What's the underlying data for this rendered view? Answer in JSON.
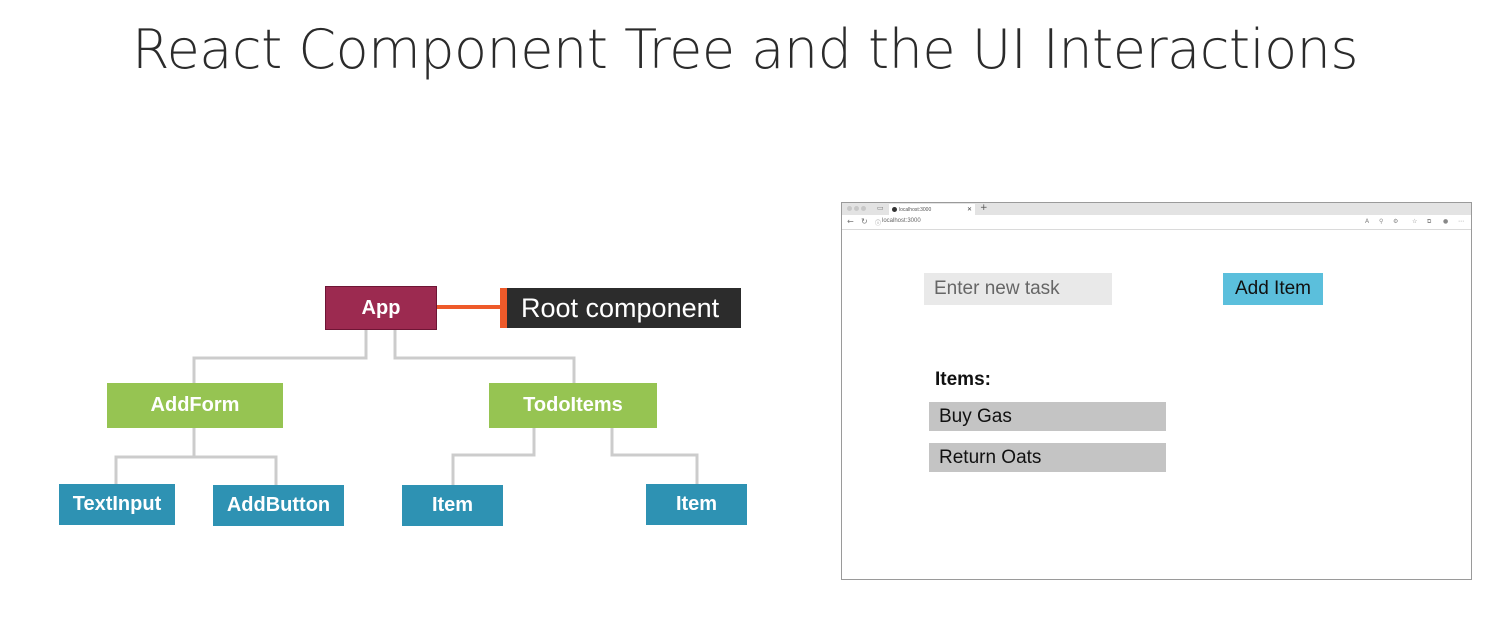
{
  "slide": {
    "title": "React Component Tree and the UI Interactions"
  },
  "tree": {
    "root": {
      "label": "App",
      "callout": "Root component",
      "color": "#9c2a50"
    },
    "add_form": {
      "label": "AddForm",
      "color": "#96c452"
    },
    "todo_items": {
      "label": "TodoItems",
      "color": "#96c452"
    },
    "text_input": {
      "label": "TextInput",
      "color": "#2e92b3"
    },
    "add_button": {
      "label": "AddButton",
      "color": "#2e92b3"
    },
    "item_1": {
      "label": "Item"
    },
    "item_2": {
      "label": "Item"
    },
    "connector_color": "#cccccc",
    "callout_accent": "#ee5a2a"
  },
  "browser": {
    "tab_title": "localhost:3000",
    "url": "localhost:3000",
    "input": {
      "placeholder": "Enter new task",
      "value": ""
    },
    "add_button_label": "Add Item",
    "items_heading": "Items:",
    "items": [
      "Buy Gas",
      "Return Oats"
    ],
    "accent_color": "#5bbfdc"
  }
}
